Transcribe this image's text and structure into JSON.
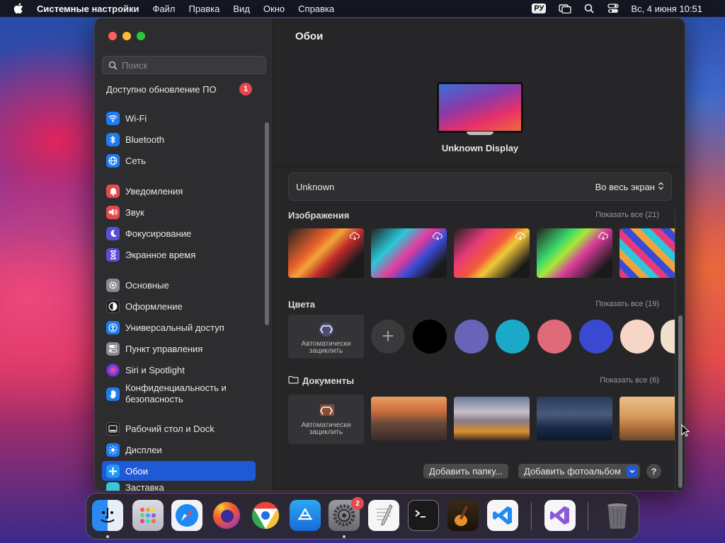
{
  "menubar": {
    "app_name": "Системные настройки",
    "menus": [
      "Файл",
      "Правка",
      "Вид",
      "Окно",
      "Справка"
    ],
    "input_lang": "РУ",
    "datetime": "Вс, 4 июня  10:51"
  },
  "sidebar": {
    "search_placeholder": "Поиск",
    "update_label": "Доступно обновление ПО",
    "update_badge": "1",
    "items": [
      {
        "label": "Wi-Fi",
        "icon": "wifi-icon",
        "color": "#1e7cf2"
      },
      {
        "label": "Bluetooth",
        "icon": "bluetooth-icon",
        "color": "#1e7cf2"
      },
      {
        "label": "Сеть",
        "icon": "globe-icon",
        "color": "#1e7cf2"
      },
      {
        "label": "Уведомления",
        "icon": "bell-icon",
        "color": "#e5484d"
      },
      {
        "label": "Звук",
        "icon": "speaker-icon",
        "color": "#e5484d"
      },
      {
        "label": "Фокусирование",
        "icon": "moon-icon",
        "color": "#5a4fd6"
      },
      {
        "label": "Экранное время",
        "icon": "hourglass-icon",
        "color": "#5a4fd6"
      },
      {
        "label": "Основные",
        "icon": "gear-icon",
        "color": "#8a8a8e"
      },
      {
        "label": "Оформление",
        "icon": "appearance-icon",
        "color": "#1c1c1e"
      },
      {
        "label": "Универсальный доступ",
        "icon": "accessibility-icon",
        "color": "#1e7cf2"
      },
      {
        "label": "Пункт управления",
        "icon": "control-center-icon",
        "color": "#8a8a8e"
      },
      {
        "label": "Siri и Spotlight",
        "icon": "siri-icon",
        "color": "#b03ad8"
      },
      {
        "label": "Конфиденциальность и безопасность",
        "icon": "hand-icon",
        "color": "#1e7cf2"
      },
      {
        "label": "Рабочий стол и Dock",
        "icon": "dock-icon",
        "color": "#1c1c1e"
      },
      {
        "label": "Дисплеи",
        "icon": "sun-icon",
        "color": "#1e7cf2"
      },
      {
        "label": "Обои",
        "icon": "wallpaper-icon",
        "color": "#1e9af2"
      },
      {
        "label": "Заставка",
        "icon": "screensaver-icon",
        "color": "#3ac6d8"
      }
    ]
  },
  "main": {
    "title": "Обои",
    "display_name": "Unknown Display",
    "selector": {
      "label": "Unknown",
      "value": "Во весь экран"
    },
    "images": {
      "title": "Изображения",
      "show_all": "Показать все (21)"
    },
    "colors": {
      "title": "Цвета",
      "show_all": "Показать все (19)",
      "auto_label": "Автоматически зациклить",
      "swatches": [
        "#000000",
        "#6a64b8",
        "#1aaac8",
        "#e06a78",
        "#3a4ad0",
        "#f6d6c6",
        "#efe0cc"
      ]
    },
    "documents": {
      "title": "Документы",
      "show_all": "Показать все (6)",
      "auto_label": "Автоматически зациклить"
    },
    "buttons": {
      "add_folder": "Добавить папку...",
      "add_album": "Добавить фотоальбом",
      "help": "?"
    }
  },
  "dock": {
    "apps": [
      "Finder",
      "Launchpad",
      "Safari",
      "Firefox",
      "Chrome",
      "App Store",
      "Системные настройки",
      "TextEdit",
      "Terminal",
      "GarageBand",
      "Visual Studio Code",
      "Visual Studio",
      "Корзина"
    ],
    "settings_badge": "2"
  }
}
